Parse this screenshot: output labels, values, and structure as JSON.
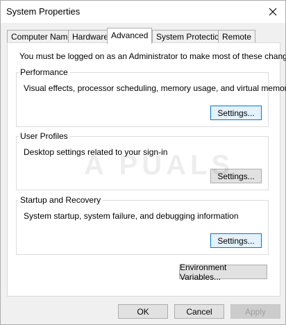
{
  "window": {
    "title": "System Properties",
    "close_icon": "close-icon"
  },
  "tabs": [
    {
      "label": "Computer Name"
    },
    {
      "label": "Hardware"
    },
    {
      "label": "Advanced",
      "active": true
    },
    {
      "label": "System Protection"
    },
    {
      "label": "Remote"
    }
  ],
  "advanced": {
    "admin_note": "You must be logged on as an Administrator to make most of these changes.",
    "performance": {
      "label": "Performance",
      "description": "Visual effects, processor scheduling, memory usage, and virtual memory",
      "settings_label": "Settings..."
    },
    "user_profiles": {
      "label": "User Profiles",
      "description": "Desktop settings related to your sign-in",
      "settings_label": "Settings..."
    },
    "startup_recovery": {
      "label": "Startup and Recovery",
      "description": "System startup, system failure, and debugging information",
      "settings_label": "Settings..."
    },
    "env_vars_label": "Environment Variables..."
  },
  "footer": {
    "ok_label": "OK",
    "cancel_label": "Cancel",
    "apply_label": "Apply"
  },
  "watermark": "A  PUALS",
  "colors": {
    "focus_border": "#0078d7",
    "dialog_bg": "#f0f0f0",
    "button_bg": "#e1e1e1"
  }
}
